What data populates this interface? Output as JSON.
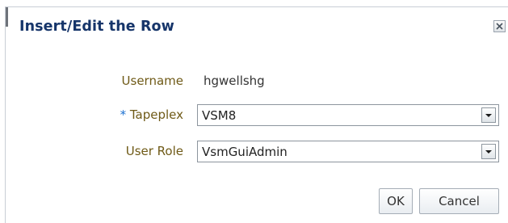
{
  "dialog": {
    "title": "Insert/Edit the Row",
    "close_icon": "close-icon"
  },
  "form": {
    "username": {
      "label": "Username",
      "value": "hgwellshg"
    },
    "tapeplex": {
      "required_marker": "*",
      "label": "Tapeplex",
      "value": "VSM8",
      "dropdown_icon": "chevron-down-icon"
    },
    "user_role": {
      "label": "User Role",
      "value": "VsmGuiAdmin",
      "dropdown_icon": "chevron-down-icon"
    }
  },
  "buttons": {
    "ok": "OK",
    "cancel": "Cancel"
  },
  "colors": {
    "title": "#16356a",
    "label": "#6f5a17",
    "required": "#1a6fd0"
  }
}
